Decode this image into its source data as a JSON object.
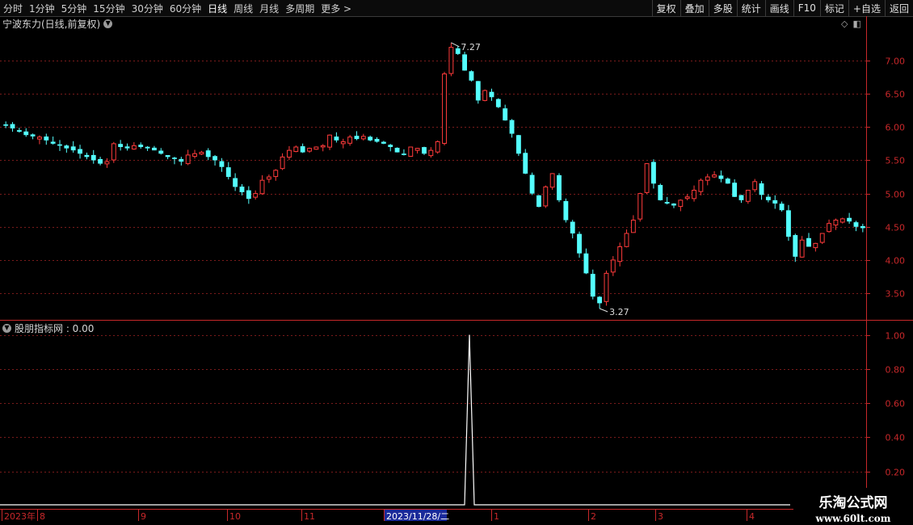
{
  "toolbar": {
    "periods": [
      "分时",
      "1分钟",
      "5分钟",
      "15分钟",
      "30分钟",
      "60分钟",
      "日线",
      "周线",
      "月线",
      "多周期",
      "更多 >"
    ],
    "active_period": "日线",
    "tools": [
      "复权",
      "叠加",
      "多股",
      "统计",
      "画线",
      "F10",
      "标记",
      "+自选",
      "返回"
    ]
  },
  "chart": {
    "title": "宁波东力(日线,前复权)",
    "high_label": "7.27",
    "low_label": "3.27"
  },
  "indicator": {
    "title": "股朋指标网 : 0.00"
  },
  "watermark": {
    "line1": "乐淘公式网",
    "line2": "www.60lt.com"
  },
  "colors": {
    "up": "#ff3b3b",
    "down": "#54ffff",
    "axis": "#c8282a",
    "grid": "#7a1b1b",
    "indicator_line": "#ffffff",
    "date_highlight": "#1a2a9a"
  },
  "chart_data": [
    {
      "type": "candlestick",
      "title": "宁波东力(日线,前复权)",
      "y_ticks": [
        3.5,
        4.0,
        4.5,
        5.0,
        5.5,
        6.0,
        6.5,
        7.0
      ],
      "ylim": [
        3.1,
        7.45
      ],
      "annotations": [
        {
          "text": "7.27",
          "value": 7.27
        },
        {
          "text": "3.27",
          "value": 3.27
        }
      ],
      "close_path": [
        6.02,
        5.98,
        5.93,
        5.88,
        5.86,
        5.85,
        5.8,
        5.75,
        5.72,
        5.68,
        5.65,
        5.6,
        5.55,
        5.5,
        5.45,
        5.48,
        5.75,
        5.7,
        5.68,
        5.72,
        5.7,
        5.68,
        5.65,
        5.6,
        5.55,
        5.52,
        5.48,
        5.58,
        5.6,
        5.62,
        5.55,
        5.5,
        5.4,
        5.25,
        5.1,
        5.02,
        4.92,
        5.0,
        5.2,
        5.25,
        5.35,
        5.55,
        5.65,
        5.7,
        5.62,
        5.68,
        5.7,
        5.72,
        5.88,
        5.8,
        5.78,
        5.85,
        5.82,
        5.86,
        5.8,
        5.78,
        5.75,
        5.7,
        5.62,
        5.58,
        5.7,
        5.68,
        5.6,
        5.65,
        5.78,
        6.8,
        7.2,
        7.1,
        6.85,
        6.7,
        6.4,
        6.55,
        6.45,
        6.3,
        6.1,
        5.9,
        5.6,
        5.3,
        5.0,
        4.8,
        5.1,
        5.3,
        4.9,
        4.6,
        4.4,
        4.1,
        3.8,
        3.45,
        3.35,
        3.8,
        4.0,
        4.2,
        4.4,
        4.6,
        5.0,
        5.45,
        5.15,
        4.9,
        4.85,
        4.82,
        4.9,
        4.95,
        5.05,
        5.2,
        5.25,
        5.28,
        5.22,
        5.15,
        4.95,
        4.9,
        5.05,
        5.18,
        4.98,
        4.9,
        4.85,
        4.75,
        4.35,
        4.05,
        4.3,
        4.2,
        4.25,
        4.4,
        4.55,
        4.6,
        4.62,
        4.58,
        4.5,
        4.48
      ]
    },
    {
      "type": "line",
      "title": "股朋指标网",
      "y_ticks": [
        0.2,
        0.4,
        0.6,
        0.8,
        1.0
      ],
      "ylim": [
        0,
        1.05
      ],
      "spike": {
        "x": "2023/11/28",
        "value": 1.0
      },
      "baseline": 0.0
    }
  ],
  "date_axis": {
    "labels": [
      "2023年",
      "8",
      "9",
      "10",
      "11",
      "2023/11/28/二",
      "1",
      "2",
      "3",
      "4"
    ],
    "highlight": "2023/11/28/二"
  }
}
